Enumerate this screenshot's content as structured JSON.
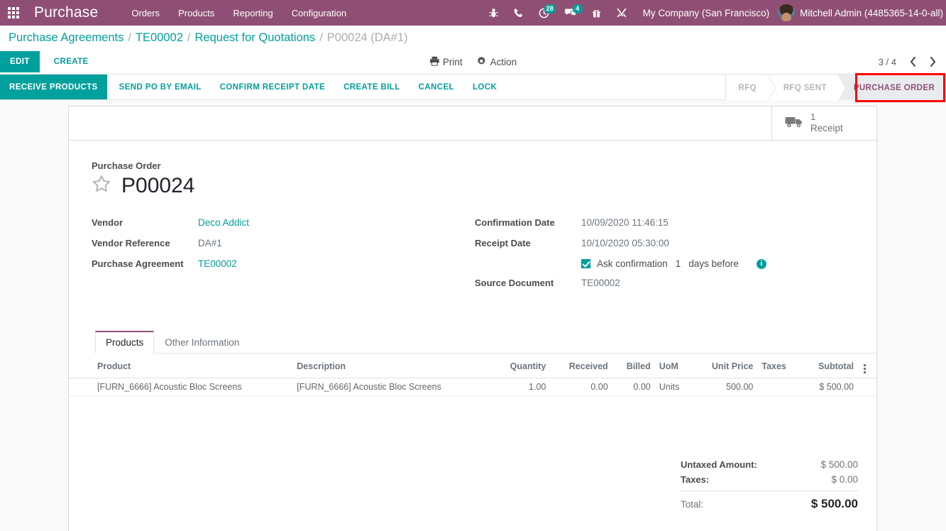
{
  "navbar": {
    "apps_icon": "apps-grid-icon",
    "brand": "Purchase",
    "menus": [
      "Orders",
      "Products",
      "Reporting",
      "Configuration"
    ],
    "systray": [
      {
        "icon": "bug-icon",
        "badge": null
      },
      {
        "icon": "phone-icon",
        "badge": null
      },
      {
        "icon": "activity-clock-icon",
        "badge": "28"
      },
      {
        "icon": "messages-icon",
        "badge": "4"
      },
      {
        "icon": "gift-icon",
        "badge": null
      },
      {
        "icon": "wrench-tools-icon",
        "badge": null
      }
    ],
    "company": "My Company (San Francisco)",
    "user": "Mitchell Admin (4485365-14-0-all)",
    "avatar": "user-avatar"
  },
  "breadcrumb": {
    "items": [
      {
        "label": "Purchase Agreements",
        "active": false
      },
      {
        "label": "TE00002",
        "active": false
      },
      {
        "label": "Request for Quotations",
        "active": false
      },
      {
        "label": "P00024 (DA#1)",
        "active": true
      }
    ],
    "separator": "/"
  },
  "control_panel": {
    "edit_label": "EDIT",
    "create_label": "CREATE",
    "print_label": "Print",
    "print_icon": "printer-icon",
    "action_label": "Action",
    "action_icon": "gear-icon",
    "pager_value": "3 / 4",
    "pager_prev_icon": "chevron-left-icon",
    "pager_next_icon": "chevron-right-icon"
  },
  "statusbar": {
    "buttons": [
      {
        "label": "RECEIVE PRODUCTS",
        "primary": true
      },
      {
        "label": "SEND PO BY EMAIL",
        "primary": false
      },
      {
        "label": "CONFIRM RECEIPT DATE",
        "primary": false
      },
      {
        "label": "CREATE BILL",
        "primary": false
      },
      {
        "label": "CANCEL",
        "primary": false
      },
      {
        "label": "LOCK",
        "primary": false
      }
    ],
    "stages": [
      {
        "label": "RFQ",
        "active": false
      },
      {
        "label": "RFQ SENT",
        "active": false
      },
      {
        "label": "PURCHASE ORDER",
        "active": true
      }
    ],
    "highlight_color": "#ff0000",
    "active_stage_color": "#8f4f74"
  },
  "button_box": {
    "receipt_icon": "truck-icon",
    "receipt_count": "1",
    "receipt_label": "Receipt"
  },
  "title": {
    "label": "Purchase Order",
    "star_icon": "star-outline-icon",
    "name": "P00024"
  },
  "form": {
    "left": [
      {
        "label": "Vendor",
        "value": "Deco Addict",
        "link": true
      },
      {
        "label": "Vendor Reference",
        "value": "DA#1",
        "link": false
      },
      {
        "label": "Purchase Agreement",
        "value": "TE00002",
        "link": true
      }
    ],
    "right": [
      {
        "label": "Confirmation Date",
        "value": "10/09/2020 11:46:15"
      },
      {
        "label": "Receipt Date",
        "value": "10/10/2020 05:30:00"
      }
    ],
    "source_document": {
      "label": "Source Document",
      "value": "TE00002"
    },
    "reminder": {
      "checked": true,
      "text_before": "Ask confirmation",
      "days": "1",
      "text_after": "days before",
      "info_icon": "info-circle-icon",
      "info_glyph": "i"
    }
  },
  "notebook": {
    "tabs": [
      {
        "label": "Products",
        "active": true
      },
      {
        "label": "Other Information",
        "active": false
      }
    ]
  },
  "lines_table": {
    "columns": [
      {
        "label": "Product",
        "align": "left"
      },
      {
        "label": "Description",
        "align": "left"
      },
      {
        "label": "Quantity",
        "align": "right"
      },
      {
        "label": "Received",
        "align": "right"
      },
      {
        "label": "Billed",
        "align": "right"
      },
      {
        "label": "UoM",
        "align": "left"
      },
      {
        "label": "Unit Price",
        "align": "right"
      },
      {
        "label": "Taxes",
        "align": "left"
      },
      {
        "label": "Subtotal",
        "align": "right"
      }
    ],
    "optional_columns_icon": "vertical-dots-icon",
    "rows": [
      {
        "product": "[FURN_6666] Acoustic Bloc Screens",
        "description": "[FURN_6666] Acoustic Bloc Screens",
        "quantity": "1.00",
        "received": "0.00",
        "billed": "0.00",
        "uom": "Units",
        "unit_price": "500.00",
        "taxes": "",
        "subtotal": "$ 500.00"
      }
    ]
  },
  "totals": {
    "untaxed_label": "Untaxed Amount:",
    "untaxed_value": "$ 500.00",
    "taxes_label": "Taxes:",
    "taxes_value": "$ 0.00",
    "total_label": "Total:",
    "total_value": "$ 500.00"
  },
  "colors": {
    "brand_purple": "#8f4f74",
    "accent_teal": "#00A09D",
    "highlight_red": "#ff0000"
  }
}
